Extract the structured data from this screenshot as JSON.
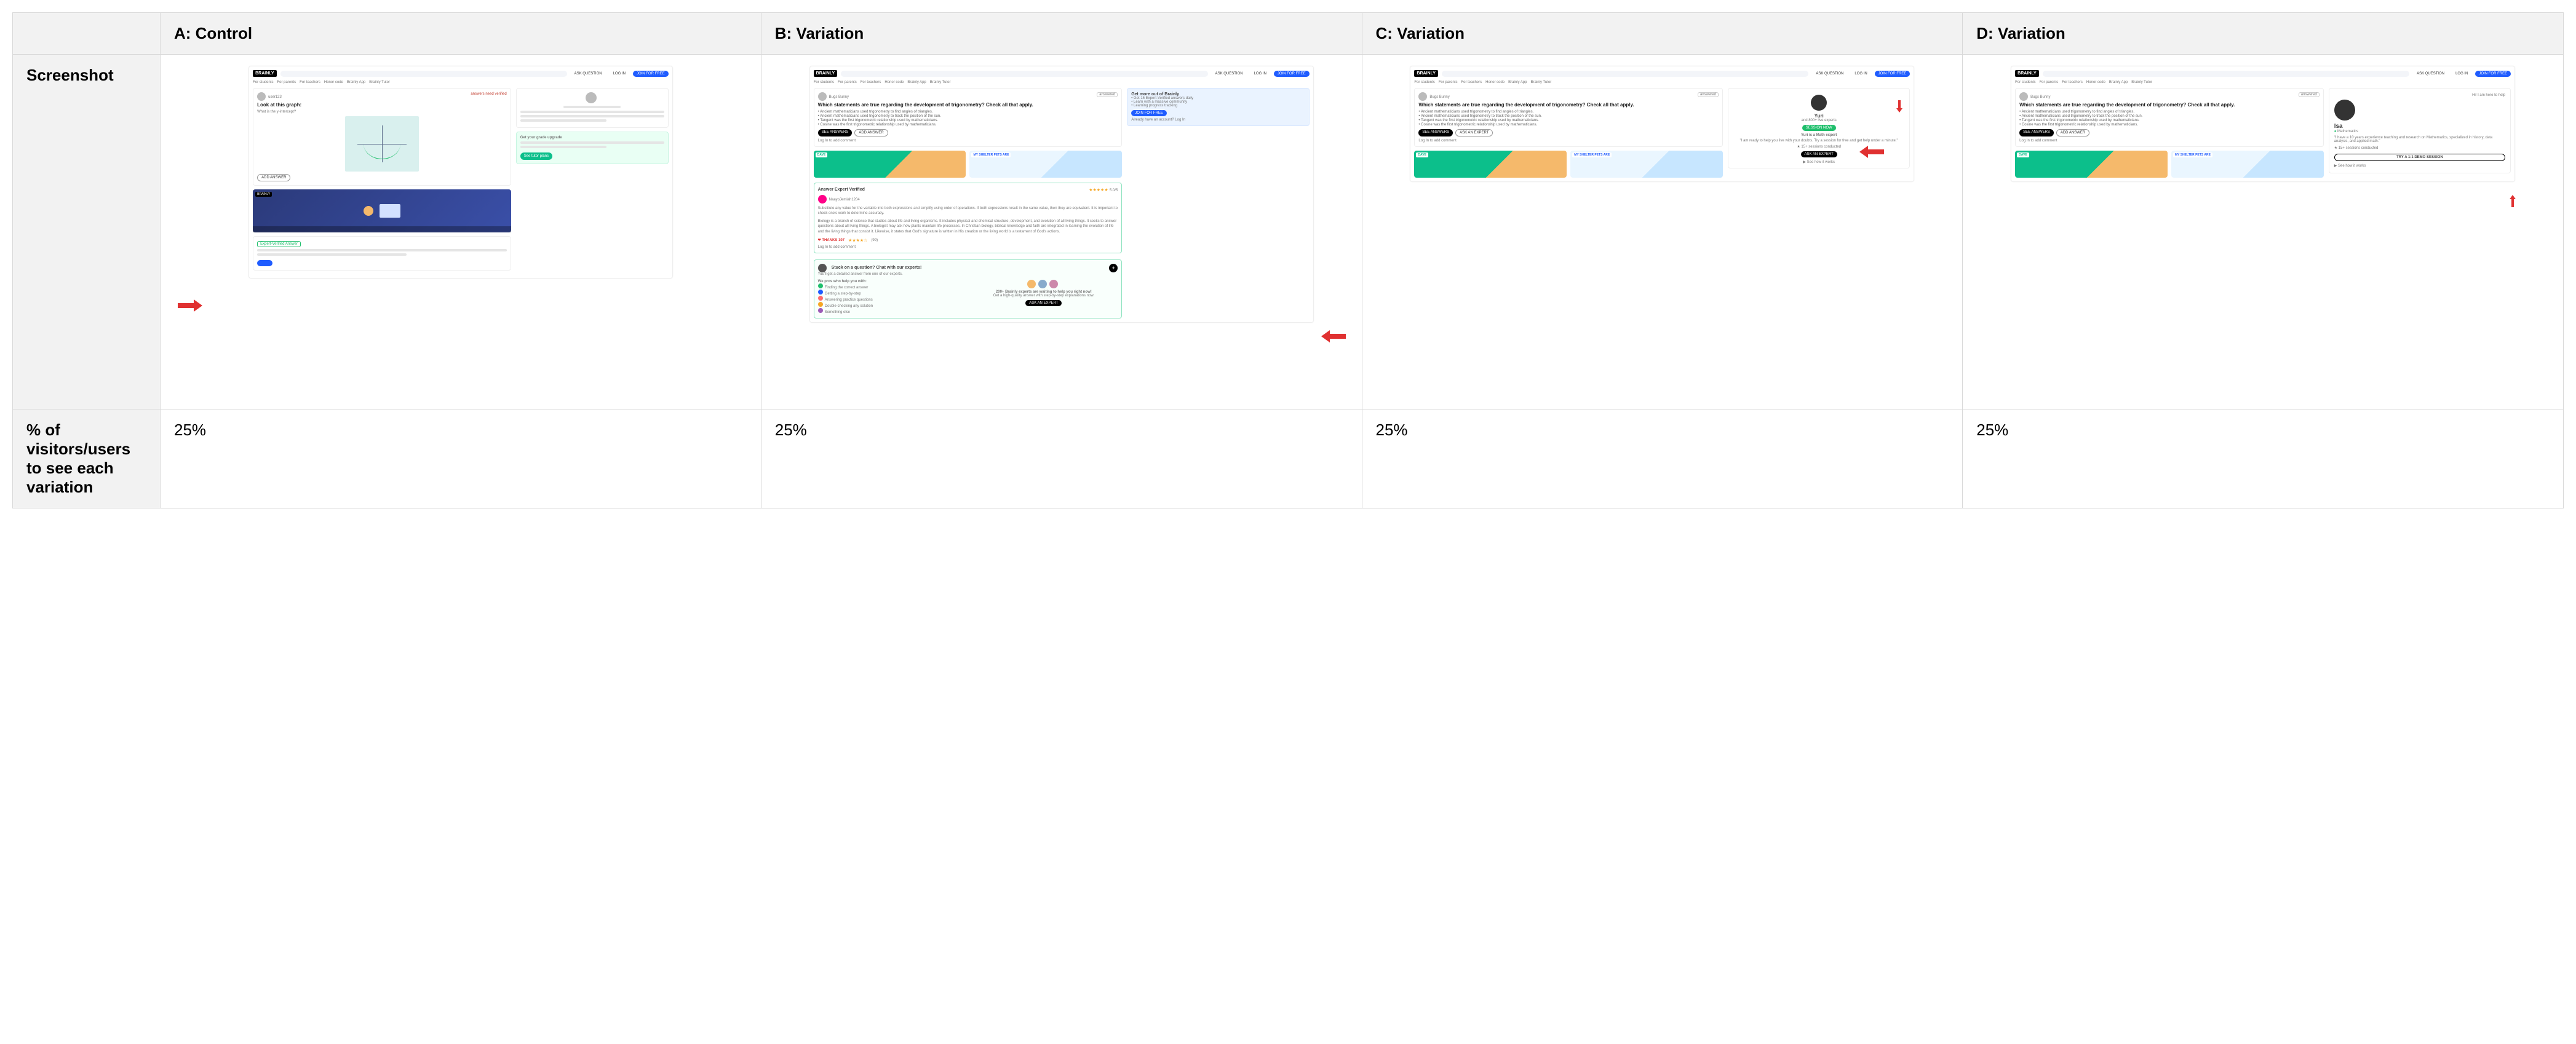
{
  "columns": {
    "a": "A: Control",
    "b": "B: Variation",
    "c": "C: Variation",
    "d": "D: Variation"
  },
  "rows": {
    "screenshot": "Screenshot",
    "pct": "% of visitors/users to see each variation"
  },
  "pct": {
    "a": "25%",
    "b": "25%",
    "c": "25%",
    "d": "25%"
  },
  "brand": "BRAINLY",
  "nav": {
    "students": "For students",
    "parents": "For parents",
    "teachers": "For teachers",
    "honor": "Honor code",
    "app": "Brainly App",
    "tutor": "Brainly Tutor"
  },
  "cta": {
    "ask": "ASK QUESTION",
    "login": "LOG IN",
    "join": "JOIN FOR FREE",
    "seeAnswers": "SEE ANSWERS",
    "addAnswer": "ADD ANSWER",
    "askExpert": "ASK AN EXPERT",
    "askExpertBtn": "ASK AN EXPERT",
    "sessionNow": "SESSION NOW",
    "demo": "TRY A 1:1 DEMO SESSION"
  },
  "question": {
    "author": "Bugs Bunny",
    "answeredBadge": "answered",
    "title": "Which statements are true regarding the development of trigonometry? Check all that apply.",
    "b1": "• Ancient mathematicians used trigonometry to find angles of triangles.",
    "b2": "• Ancient mathematicians used trigonometry to track the position of the sun.",
    "b3": "• Tangent was the first trigonometric relationship used by mathematicians.",
    "b4": "• Cosine was the first trigonometric relationship used by mathematicians.",
    "logInAdd": "Log In to add comment"
  },
  "control": {
    "author": "user123",
    "answeredBadge": "answers need verified",
    "graphTitle": "Look at this graph:",
    "graphQ": "What is the y-intercept?",
    "addAnswerPill": "ADD ANSWER",
    "expertVerified": "Expert-Verified Answer",
    "gradeTitle": "Get your grade upgrade",
    "gradeBtn": "See tutor plans"
  },
  "thumbs": {
    "dave": "DAVE",
    "pets": "MY SHELTER PETS ARE"
  },
  "answer": {
    "verified": "Answer Expert Verified",
    "stars": "★★★★★",
    "ratingTiny": "5.0/5",
    "author": "NaayoJemiah1204",
    "p1": "Substitute any value for the variable into both expressions and simplify using order of operations. If both expressions result in the same value, then they are equivalent. It is important to check one's work to determine accuracy.",
    "p2": "Biology is a branch of science that studies about life and living organisms. It includes physical and chemical structure, development, and evolution of all living things. It seeks to answer questions about all living things. A biologist may ask how plants maintain life processes. In Christian biology, biblical knowledge and faith are integrated in learning the evolution of life and the living things that consist it. Likewise, it states that God's signature is written in His creation or the living world is a testament of God's actions.",
    "thanks": "THANKS 107",
    "thanksStars": "★★★★☆",
    "thanksTiny": "(99)",
    "loginComment": "Log In to add comment"
  },
  "sidebox": {
    "title": "Get more out of Brainly",
    "li1": "• Get 15 Expert-Verified answers daily",
    "li2": "• Learn with a massive community",
    "li3": "• Learning progress tracking",
    "already": "Already have an account? Log In"
  },
  "expertPromo": {
    "headline": "Stuck on a question? Chat with our experts!",
    "sub": "You'll get a detailed answer from one of our experts.",
    "leftTitle": "We pros who help you with:",
    "l1": "Finding the correct answer",
    "l2": "Getting a step-by-step",
    "l3": "Answering practice questions",
    "l4": "Double-checking any solution",
    "l5": "Something else",
    "rightLine1": "200+ Brainly experts are waiting to help you right now!",
    "rightLine2": "Get a high-quality answer with step-by-step explanations now."
  },
  "yuri": {
    "name": "Yuri",
    "and": "and 800+ live experts",
    "role": "Yuri is a Math expert",
    "pitch1": "\"I am ready to help you live with your doubts. Try a session for free and get help under a minute.\"",
    "sessions": "15+ sessions conducted",
    "footer": "See how it works"
  },
  "isa": {
    "hello": "Hi! I am here to help",
    "name": "Isa",
    "badge": "Mathematics",
    "bio": "\"I have a 10 years experience teaching and research on Mathematics, specialized in history, data analysis, and applied math.\"",
    "sessions": "15+ sessions conducted",
    "footer": "See how it works"
  }
}
